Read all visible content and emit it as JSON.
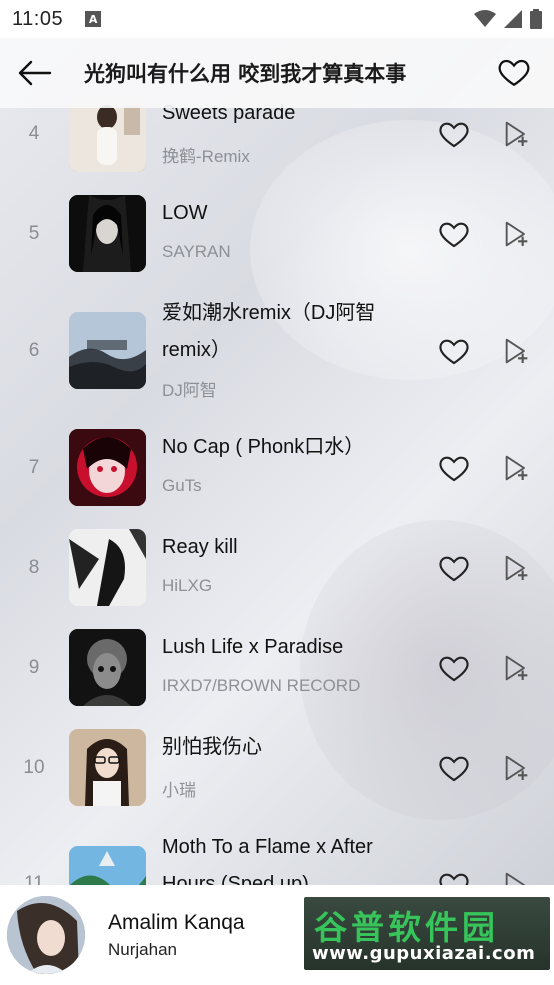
{
  "status_bar": {
    "time": "11:05",
    "notification_icon": "a-box-icon",
    "icons": [
      "wifi-icon",
      "signal-icon",
      "battery-icon"
    ]
  },
  "header": {
    "title": "光狗叫有什么用 咬到我才算真本事",
    "back_icon": "arrow-left-icon",
    "favorite_icon": "heart-outline-icon"
  },
  "songs": [
    {
      "index": "4",
      "title": "Sweets parade",
      "artist": "挽鹤-Remix"
    },
    {
      "index": "5",
      "title": "LOW",
      "artist": "SAYRAN"
    },
    {
      "index": "6",
      "title": "爱如潮水remix（DJ阿智remix）",
      "artist": "DJ阿智"
    },
    {
      "index": "7",
      "title": "No Cap ( Phonk口水）",
      "artist": "GuTs"
    },
    {
      "index": "8",
      "title": "Reay kill",
      "artist": "HiLXG"
    },
    {
      "index": "9",
      "title": "Lush Life x Paradise",
      "artist": "IRXD7/BROWN RECORD"
    },
    {
      "index": "10",
      "title": "别怕我伤心",
      "artist": "小瑞"
    },
    {
      "index": "11",
      "title": "Moth To a Flame x After Hours (Sped up)",
      "artist": ""
    }
  ],
  "player": {
    "title": "Amalim Kanqa",
    "artist": "Nurjahan"
  },
  "watermark": {
    "main": "谷普软件园",
    "url": "www.gupuxiazai.com"
  },
  "colors": {
    "header_bg": "#f8f8fa",
    "muted_text": "#8d9096",
    "watermark_green": "#37c45a"
  }
}
